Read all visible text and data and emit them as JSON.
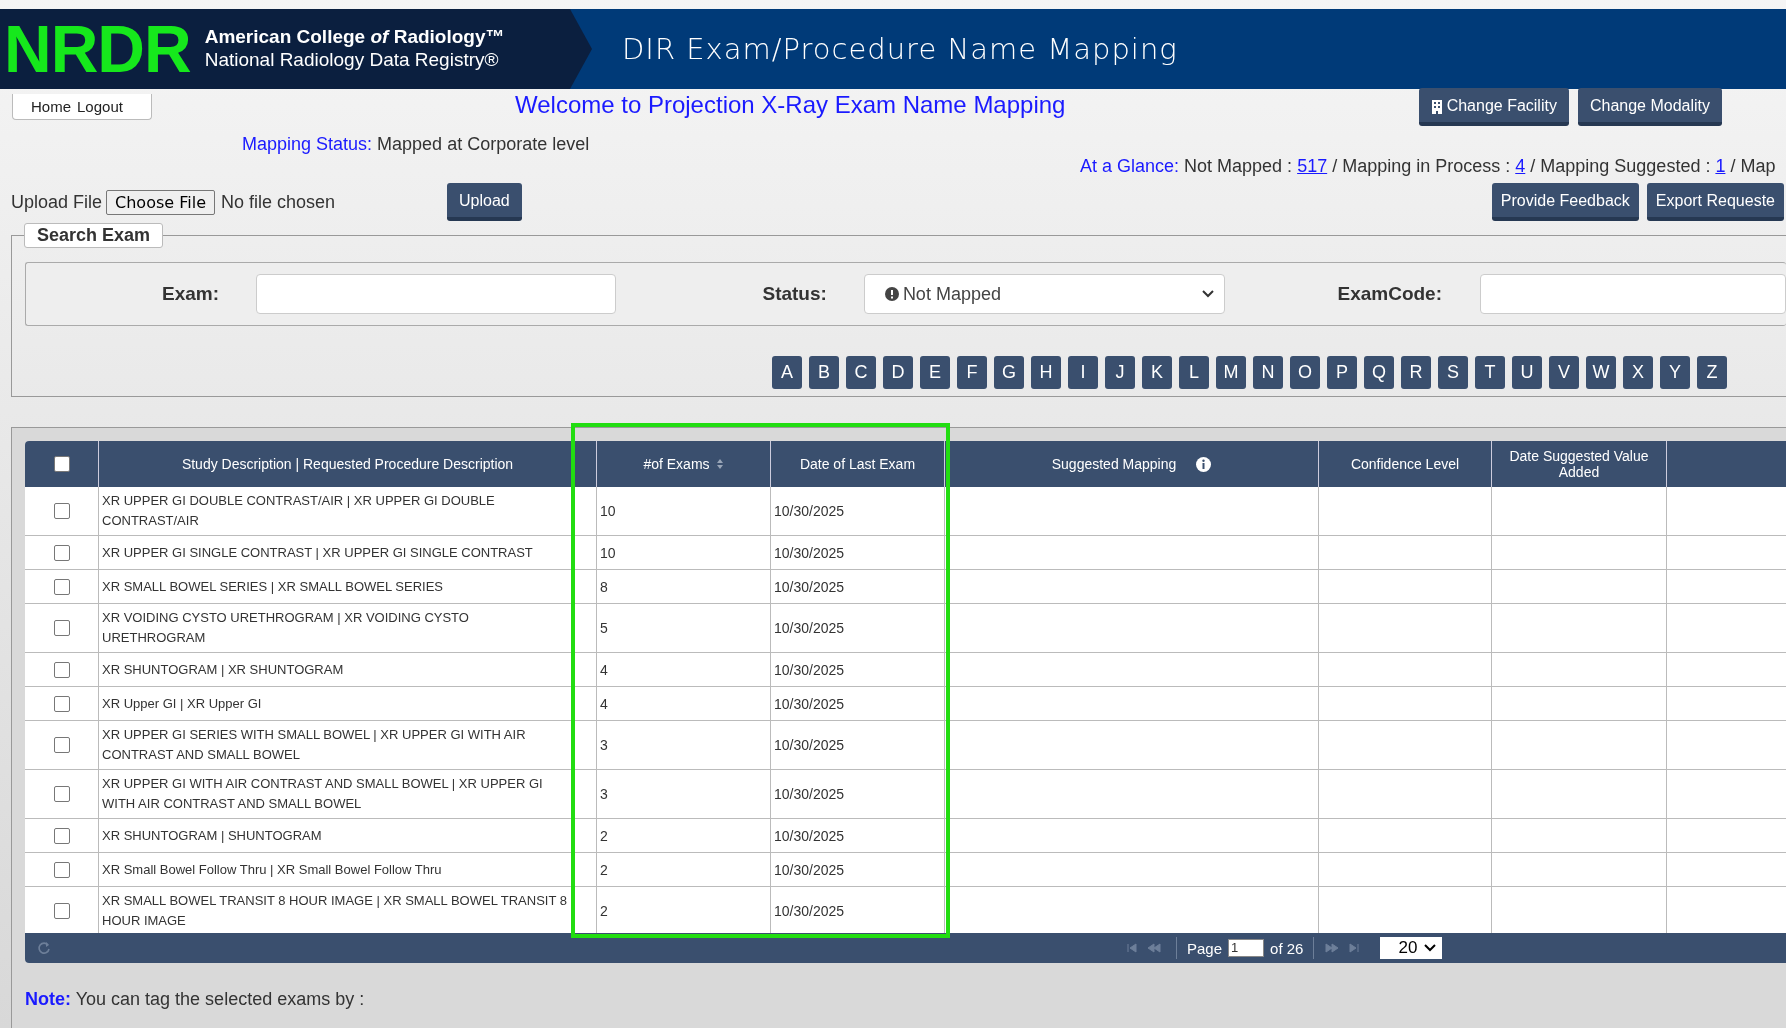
{
  "header": {
    "logo": "NRDR",
    "org_line1": "American College *of* Radiology™",
    "org_line2": "National Radiology Data Registry®",
    "title": "DIR Exam/Procedure Name Mapping"
  },
  "nav": [
    "Home",
    "Logout"
  ],
  "welcome": "Welcome to Projection X-Ray Exam Name Mapping",
  "top_buttons": [
    {
      "label": "Change Facility",
      "icon": true
    },
    {
      "label": "Change Modality",
      "icon": false
    }
  ],
  "mapping_status": {
    "label": "Mapping Status:",
    "value": "Mapped at Corporate level"
  },
  "at_a_glance": {
    "label": "At a Glance:",
    "items": [
      {
        "text": "Not Mapped :",
        "count": "517"
      },
      {
        "text": "/ Mapping in Process :",
        "count": "4"
      },
      {
        "text": "/ Mapping Suggested :",
        "count": "1"
      },
      {
        "text": "/ Map"
      }
    ]
  },
  "upload": {
    "label": "Upload File",
    "choose": "Choose File",
    "file": "No file chosen",
    "button": "Upload"
  },
  "actions": [
    "Provide Feedback",
    "Export Requeste"
  ],
  "search": {
    "legend": "Search Exam",
    "exam_label": "Exam:",
    "status_label": "Status:",
    "status_value": "Not Mapped",
    "examcode_label": "ExamCode:"
  },
  "letters": [
    "A",
    "B",
    "C",
    "D",
    "E",
    "F",
    "G",
    "H",
    "I",
    "J",
    "K",
    "L",
    "M",
    "N",
    "O",
    "P",
    "Q",
    "R",
    "S",
    "T",
    "U",
    "V",
    "W",
    "X",
    "Y",
    "Z"
  ],
  "table": {
    "header_checked": false,
    "columns": [
      {
        "label": "Study Description | Requested Procedure Description",
        "sortable": false,
        "info": false
      },
      {
        "label": "#of Exams",
        "sortable": true,
        "info": false
      },
      {
        "label": "Date of Last Exam",
        "sortable": false,
        "info": false
      },
      {
        "label": "Suggested Mapping",
        "sortable": false,
        "info": true
      },
      {
        "label": "Confidence Level",
        "sortable": false,
        "info": false
      },
      {
        "label": "Date Suggested Value Added",
        "sortable": false,
        "info": false
      }
    ],
    "rows": [
      {
        "checked": false,
        "description": "XR UPPER GI DOUBLE CONTRAST/AIR | XR UPPER GI DOUBLE CONTRAST/AIR",
        "exams": "10",
        "date": "10/30/2025"
      },
      {
        "checked": false,
        "description": "XR UPPER GI SINGLE CONTRAST | XR UPPER GI SINGLE CONTRAST",
        "exams": "10",
        "date": "10/30/2025"
      },
      {
        "checked": false,
        "description": "XR SMALL BOWEL SERIES | XR SMALL BOWEL SERIES",
        "exams": "8",
        "date": "10/30/2025"
      },
      {
        "checked": false,
        "description": "XR VOIDING CYSTO URETHROGRAM | XR VOIDING CYSTO URETHROGRAM",
        "exams": "5",
        "date": "10/30/2025"
      },
      {
        "checked": false,
        "description": "XR SHUNTOGRAM | XR SHUNTOGRAM",
        "exams": "4",
        "date": "10/30/2025"
      },
      {
        "checked": false,
        "description": "XR Upper GI | XR Upper GI",
        "exams": "4",
        "date": "10/30/2025"
      },
      {
        "checked": false,
        "description": "XR UPPER GI SERIES WITH SMALL BOWEL | XR UPPER GI WITH AIR CONTRAST AND SMALL BOWEL",
        "exams": "3",
        "date": "10/30/2025"
      },
      {
        "checked": false,
        "description": "XR UPPER GI WITH AIR CONTRAST AND SMALL BOWEL | XR UPPER GI WITH AIR CONTRAST AND SMALL BOWEL",
        "exams": "3",
        "date": "10/30/2025"
      },
      {
        "checked": false,
        "description": "XR SHUNTOGRAM | SHUNTOGRAM",
        "exams": "2",
        "date": "10/30/2025"
      },
      {
        "checked": false,
        "description": "XR Small Bowel Follow Thru | XR Small Bowel Follow Thru",
        "exams": "2",
        "date": "10/30/2025"
      },
      {
        "checked": false,
        "description": "XR SMALL BOWEL TRANSIT 8 HOUR IMAGE | XR SMALL BOWEL TRANSIT 8 HOUR IMAGE",
        "exams": "2",
        "date": "10/30/2025"
      }
    ]
  },
  "pager": {
    "page_label": "Page",
    "page": "1",
    "of": "of 26",
    "page_size": "20"
  },
  "note": {
    "label": "Note:",
    "text": "You can tag the selected exams by :"
  }
}
